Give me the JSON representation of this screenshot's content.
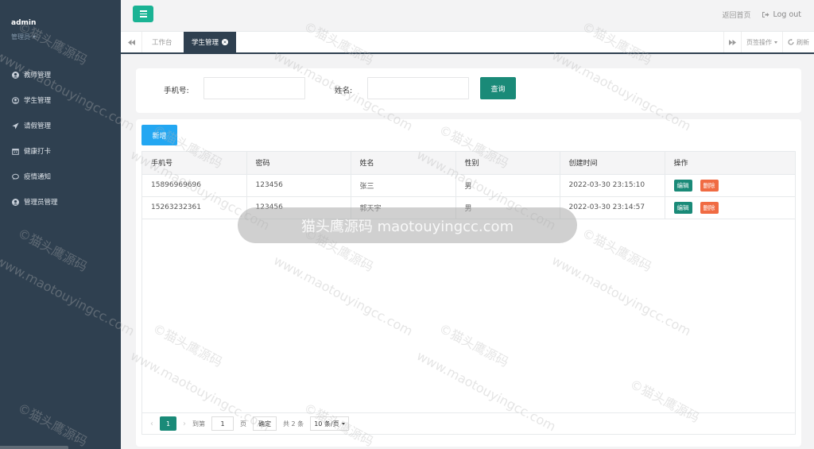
{
  "sidebar": {
    "username": "admin",
    "role": "管理员",
    "items": [
      {
        "label": "教师管理",
        "icon": "user-circle-icon"
      },
      {
        "label": "学生管理",
        "icon": "user-circle-o-icon"
      },
      {
        "label": "请假管理",
        "icon": "paper-plane-icon"
      },
      {
        "label": "健康打卡",
        "icon": "calendar-icon"
      },
      {
        "label": "疫情通知",
        "icon": "comment-icon"
      },
      {
        "label": "管理员管理",
        "icon": "user-circle-icon"
      }
    ]
  },
  "topbar": {
    "home_link": "返回首页",
    "logout": "Log out"
  },
  "tabs": {
    "items": [
      "工作台",
      "学生管理"
    ],
    "tab_ops": "页签操作",
    "refresh": "刷新"
  },
  "search": {
    "phone_label": "手机号:",
    "name_label": "姓名:",
    "phone_value": "",
    "name_value": "",
    "button": "查询"
  },
  "table": {
    "add_button": "新增",
    "columns": [
      "手机号",
      "密码",
      "姓名",
      "性别",
      "创建时间",
      "操作"
    ],
    "rows": [
      {
        "phone": "15896969696",
        "password": "123456",
        "name": "张三",
        "gender": "男",
        "created": "2022-03-30 23:15:10"
      },
      {
        "phone": "15263232361",
        "password": "123456",
        "name": "郭天宇",
        "gender": "男",
        "created": "2022-03-30 23:14:57"
      }
    ],
    "edit_label": "编辑",
    "delete_label": "删除"
  },
  "pager": {
    "current_page": "1",
    "goto_label": "到第",
    "goto_value": "1",
    "page_unit": "页",
    "confirm": "确定",
    "total": "共 2 条",
    "page_size": "10 条/页"
  },
  "watermark": {
    "text1": "©猫头鹰源码",
    "text2": "www.maotouyingcc.com",
    "banner": "猫头鹰源码 maotouyingcc.com"
  },
  "colors": {
    "sidebar_bg": "#2f4050",
    "primary_green": "#1a8a78",
    "menu_green": "#1ab394",
    "add_blue": "#23a7f2",
    "delete_orange": "#f06b43"
  }
}
